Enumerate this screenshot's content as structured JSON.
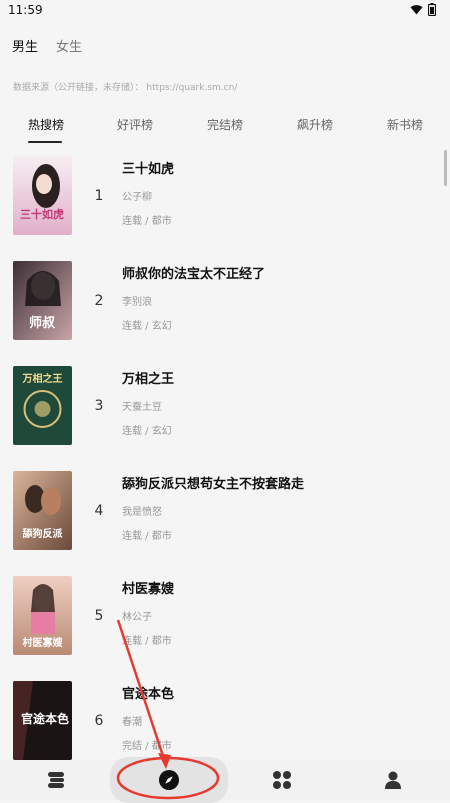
{
  "status_bar": {
    "time": "11:59"
  },
  "gender_tabs": [
    {
      "label": "男生",
      "active": true
    },
    {
      "label": "女生",
      "active": false
    }
  ],
  "source_note": "数据来源（公开链接，未存储）：  https://quark.sm.cn/",
  "rank_tabs": [
    {
      "label": "热搜榜",
      "active": true
    },
    {
      "label": "好评榜",
      "active": false
    },
    {
      "label": "完结榜",
      "active": false
    },
    {
      "label": "飙升榜",
      "active": false
    },
    {
      "label": "新书榜",
      "active": false
    }
  ],
  "books": [
    {
      "rank": "1",
      "title": "三十如虎",
      "author": "公子柳",
      "meta": "连载 / 都市",
      "cover_text": "三十如虎",
      "cover_colors": [
        "#f3e6ee",
        "#d8a0b8"
      ]
    },
    {
      "rank": "2",
      "title": "师叔你的法宝太不正经了",
      "author": "李别浪",
      "meta": "连载 / 玄幻",
      "cover_text": "师叔",
      "cover_colors": [
        "#3b2f36",
        "#c9a4a8"
      ]
    },
    {
      "rank": "3",
      "title": "万相之王",
      "author": "天蚕土豆",
      "meta": "连载 / 玄幻",
      "cover_text": "万相之王",
      "cover_colors": [
        "#1f4a3a",
        "#4b8a62"
      ]
    },
    {
      "rank": "4",
      "title": "舔狗反派只想苟女主不按套路走",
      "author": "我是愤怒",
      "meta": "连载 / 都市",
      "cover_text": "舔狗反派",
      "cover_colors": [
        "#6b4a3a",
        "#d9b59a"
      ]
    },
    {
      "rank": "5",
      "title": "村医寡嫂",
      "author": "林公子",
      "meta": "连载 / 都市",
      "cover_text": "村医寡嫂",
      "cover_colors": [
        "#b88a74",
        "#f0cfc3"
      ]
    },
    {
      "rank": "6",
      "title": "官途本色",
      "author": "春潮",
      "meta": "完结 / 都市",
      "cover_text": "官途本色",
      "cover_colors": [
        "#1b1414",
        "#5a2a2a"
      ]
    }
  ],
  "bottom_nav": [
    {
      "icon": "bookshelf-icon",
      "active": false
    },
    {
      "icon": "compass-icon",
      "active": true
    },
    {
      "icon": "apps-icon",
      "active": false
    },
    {
      "icon": "profile-icon",
      "active": false
    }
  ],
  "accent_color": "#222222",
  "annotation_color": "#e53a2f"
}
